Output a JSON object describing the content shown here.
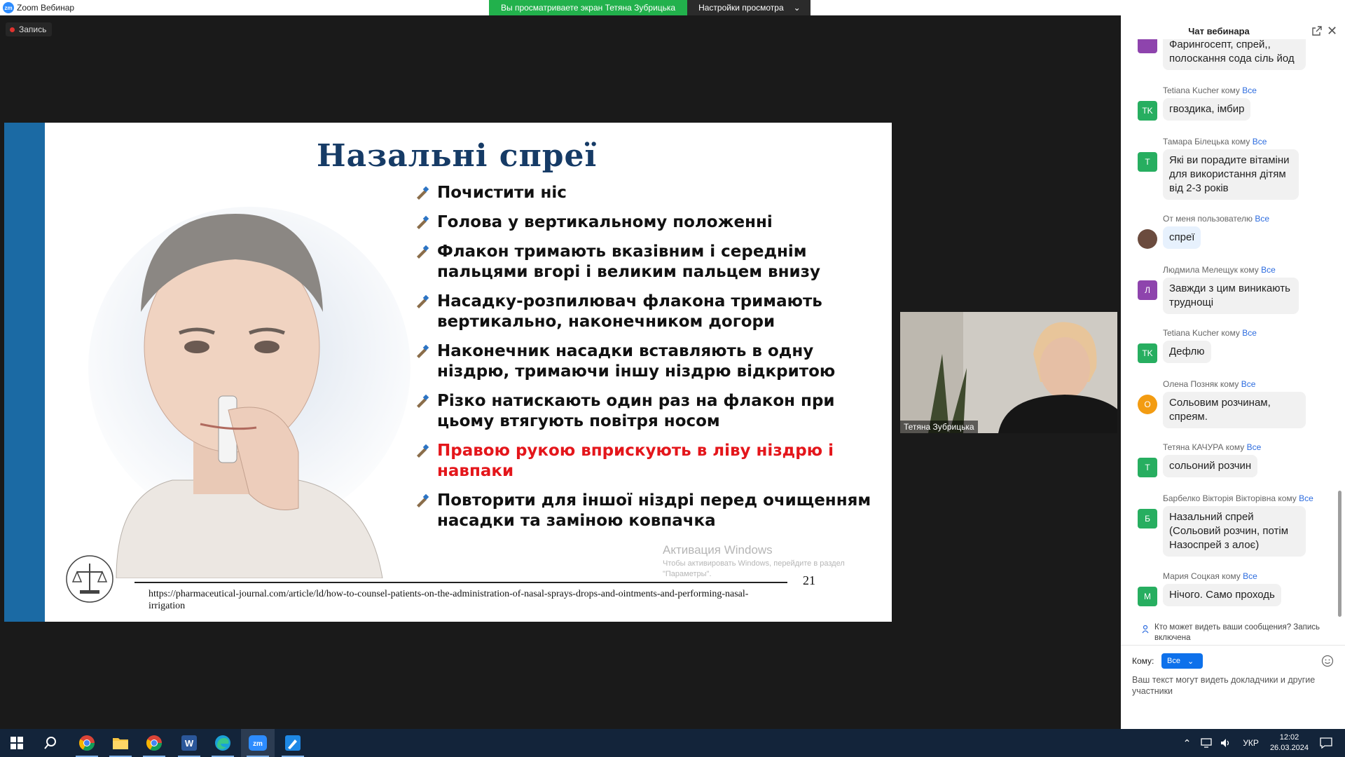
{
  "window": {
    "title": "Zoom Вебинар",
    "share_banner": "Вы просматриваете экран Тетяна Зубрицька",
    "view_settings": "Настройки просмотра",
    "recording_label": "Запись",
    "minimize_glyph": "—",
    "restore_glyph": "❐",
    "close_glyph": "✕"
  },
  "slide": {
    "title": "Назальні спреї",
    "bullets": [
      {
        "text": "Почистити ніс",
        "highlight": false
      },
      {
        "text": "Голова у вертикальному положенні",
        "highlight": false
      },
      {
        "text": "Флакон тримають вказівним і середнім пальцями вгорі і великим пальцем внизу",
        "highlight": false
      },
      {
        "text": "Насадку-розпилювач  флакона тримають вертикально, наконечником догори",
        "highlight": false
      },
      {
        "text": "Наконечник насадки вставляють в одну ніздрю, тримаючи іншу ніздрю відкритою",
        "highlight": false
      },
      {
        "text": "Різко натискають один раз на флакон при цьому втягують повітря носом",
        "highlight": false
      },
      {
        "text": "Правою рукою вприскують в ліву ніздрю і навпаки",
        "highlight": true
      },
      {
        "text": "Повторити для іншої ніздрі перед очищенням насадки та заміною ковпачка",
        "highlight": false
      }
    ],
    "page_number": "21",
    "source_url": "https://pharmaceutical-journal.com/article/ld/how-to-counsel-patients-on-the-administration-of-nasal-sprays-drops-and-ointments-and-performing-nasal-irrigation",
    "watermark_title": "Активация Windows",
    "watermark_text": "Чтобы активировать Windows, перейдите в раздел \"Параметры\".",
    "accent_color": "#1b6aa4",
    "title_color": "#163b66",
    "highlight_color": "#e4161b"
  },
  "video": {
    "participant_name": "Тетяна Зубрицька"
  },
  "chat": {
    "title": "Чат вебинара",
    "messages": [
      {
        "sender": "",
        "to_label": "",
        "to": "",
        "avatar": "",
        "avatar_color": "#8e44ad",
        "text": "Фарингосепт, спрей,, полоскання сода сіль йод"
      },
      {
        "sender": "Tetiana Kucher",
        "to_label": "кому",
        "to": "Все",
        "avatar": "TK",
        "avatar_color": "#27ae60",
        "text": "гвоздика, імбир"
      },
      {
        "sender": "Тамара Білецька",
        "to_label": "кому",
        "to": "Все",
        "avatar": "T",
        "avatar_color": "#27ae60",
        "text": "Які ви порадите вітаміни для використання дітям від 2-3 років"
      },
      {
        "sender": "От меня пользователю",
        "to_label": "",
        "to": "Все",
        "avatar": "",
        "avatar_color": "#6b4b3e",
        "text": "спреї"
      },
      {
        "sender": "Людмила Мелещук",
        "to_label": "кому",
        "to": "Все",
        "avatar": "Л",
        "avatar_color": "#8e44ad",
        "text": "Завжди з цим виникають труднощі"
      },
      {
        "sender": "Tetiana Kucher",
        "to_label": "кому",
        "to": "Все",
        "avatar": "TK",
        "avatar_color": "#27ae60",
        "text": "Дефлю"
      },
      {
        "sender": "Олена Позняк",
        "to_label": "кому",
        "to": "Все",
        "avatar": "O",
        "avatar_color": "#f39c12",
        "text": "Сольовим розчинам, спреям."
      },
      {
        "sender": "Тетяна КАЧУРА",
        "to_label": "кому",
        "to": "Все",
        "avatar": "T",
        "avatar_color": "#27ae60",
        "text": "сольоний розчин"
      },
      {
        "sender": "Барбелко Вікторія Вікторівна",
        "to_label": "кому",
        "to": "Все",
        "avatar": "Б",
        "avatar_color": "#27ae60",
        "text": "Назальний спрей (Сольовий розчин, потім Назоспрей з алоє)"
      },
      {
        "sender": "Мария Соцкая",
        "to_label": "кому",
        "to": "Все",
        "avatar": "M",
        "avatar_color": "#27ae60",
        "text": "Нічого. Само проходь"
      }
    ],
    "privacy_note": "Кто может видеть ваши сообщения? Запись включена",
    "to_label": "Кому:",
    "to_value": "Все",
    "compose_placeholder": "Ваш текст могут видеть докладчики и другие участники"
  },
  "taskbar": {
    "language": "УКР",
    "time": "12:02",
    "date": "26.03.2024",
    "apps": [
      "windows-start",
      "search",
      "chrome",
      "file-explorer",
      "chrome-profile",
      "word",
      "edge",
      "zoom",
      "paint"
    ]
  }
}
